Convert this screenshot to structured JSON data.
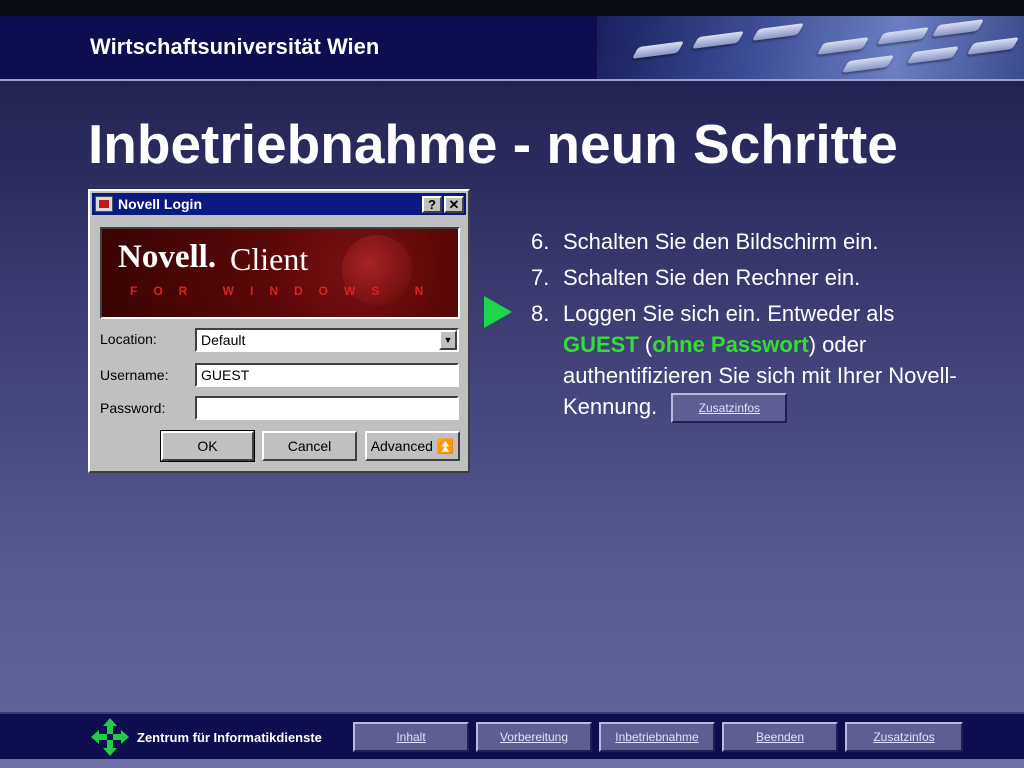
{
  "header": {
    "title": "Wirtschaftsuniversität Wien"
  },
  "page_title": "Inbetriebnahme - neun Schritte",
  "dialog": {
    "title": "Novell Login",
    "help_label": "?",
    "close_label": "✕",
    "banner_novell": "Novell.",
    "banner_client": "Client",
    "banner_sub": "FOR WINDOWS N",
    "location_label": "Location:",
    "location_value": "Default",
    "username_label": "Username:",
    "username_value": "GUEST",
    "password_label": "Password:",
    "password_value": "",
    "ok_label": "OK",
    "cancel_label": "Cancel",
    "advanced_label": "Advanced"
  },
  "steps": [
    {
      "num": "6.",
      "text": "Schalten Sie den Bildschirm ein."
    },
    {
      "num": "7.",
      "text": "Schalten Sie den Rechner ein."
    },
    {
      "num": "8.",
      "text_a": "Loggen Sie sich ein. Entweder als",
      "guest": "GUEST",
      "paren_open": " (",
      "ohne": "ohne Passwort",
      "text_b": ") oder authentifizieren Sie sich mit Ihrer Novell-Kennung.",
      "button": "Zusatzinfos"
    }
  ],
  "footer": {
    "org": "Zentrum für Informatikdienste",
    "nav": [
      "Inhalt",
      "Vorbereitung",
      "Inbetriebnahme",
      "Beenden",
      "Zusatzinfos"
    ]
  },
  "colors": {
    "accent_green": "#33dd33",
    "header_bg": "#0d0d50",
    "dialog_title": "#0a1a80"
  }
}
